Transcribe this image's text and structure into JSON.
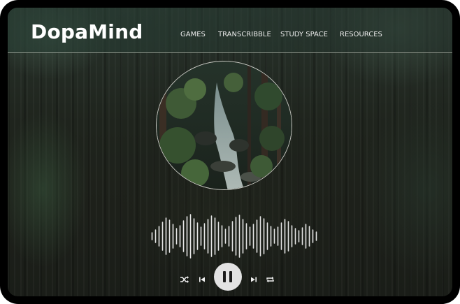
{
  "app": {
    "logo": "DopaMind"
  },
  "nav": {
    "items": [
      {
        "label": "GAMES"
      },
      {
        "label": "TRANSCRIBBLE"
      },
      {
        "label": "STUDY SPACE"
      },
      {
        "label": "RESOURCES"
      }
    ]
  },
  "player": {
    "artwork_icon": "forest-stream-image",
    "waveform_icon": "audio-waveform",
    "state": "playing",
    "controls": {
      "shuffle_icon": "shuffle-icon",
      "previous_icon": "skip-previous-icon",
      "play_pause_icon": "pause-icon",
      "next_icon": "skip-next-icon",
      "repeat_icon": "repeat-icon"
    }
  },
  "colors": {
    "text": "#ffffff",
    "pause_button": "#e2e2e2",
    "background": "#1f241d"
  }
}
